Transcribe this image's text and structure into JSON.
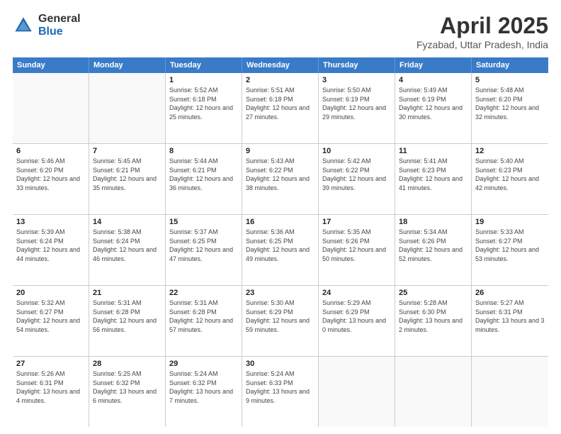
{
  "header": {
    "logo_general": "General",
    "logo_blue": "Blue",
    "month_title": "April 2025",
    "location": "Fyzabad, Uttar Pradesh, India"
  },
  "days_of_week": [
    "Sunday",
    "Monday",
    "Tuesday",
    "Wednesday",
    "Thursday",
    "Friday",
    "Saturday"
  ],
  "weeks": [
    [
      {
        "day": "",
        "sunrise": "",
        "sunset": "",
        "daylight": ""
      },
      {
        "day": "",
        "sunrise": "",
        "sunset": "",
        "daylight": ""
      },
      {
        "day": "1",
        "sunrise": "Sunrise: 5:52 AM",
        "sunset": "Sunset: 6:18 PM",
        "daylight": "Daylight: 12 hours and 25 minutes."
      },
      {
        "day": "2",
        "sunrise": "Sunrise: 5:51 AM",
        "sunset": "Sunset: 6:18 PM",
        "daylight": "Daylight: 12 hours and 27 minutes."
      },
      {
        "day": "3",
        "sunrise": "Sunrise: 5:50 AM",
        "sunset": "Sunset: 6:19 PM",
        "daylight": "Daylight: 12 hours and 29 minutes."
      },
      {
        "day": "4",
        "sunrise": "Sunrise: 5:49 AM",
        "sunset": "Sunset: 6:19 PM",
        "daylight": "Daylight: 12 hours and 30 minutes."
      },
      {
        "day": "5",
        "sunrise": "Sunrise: 5:48 AM",
        "sunset": "Sunset: 6:20 PM",
        "daylight": "Daylight: 12 hours and 32 minutes."
      }
    ],
    [
      {
        "day": "6",
        "sunrise": "Sunrise: 5:46 AM",
        "sunset": "Sunset: 6:20 PM",
        "daylight": "Daylight: 12 hours and 33 minutes."
      },
      {
        "day": "7",
        "sunrise": "Sunrise: 5:45 AM",
        "sunset": "Sunset: 6:21 PM",
        "daylight": "Daylight: 12 hours and 35 minutes."
      },
      {
        "day": "8",
        "sunrise": "Sunrise: 5:44 AM",
        "sunset": "Sunset: 6:21 PM",
        "daylight": "Daylight: 12 hours and 36 minutes."
      },
      {
        "day": "9",
        "sunrise": "Sunrise: 5:43 AM",
        "sunset": "Sunset: 6:22 PM",
        "daylight": "Daylight: 12 hours and 38 minutes."
      },
      {
        "day": "10",
        "sunrise": "Sunrise: 5:42 AM",
        "sunset": "Sunset: 6:22 PM",
        "daylight": "Daylight: 12 hours and 39 minutes."
      },
      {
        "day": "11",
        "sunrise": "Sunrise: 5:41 AM",
        "sunset": "Sunset: 6:23 PM",
        "daylight": "Daylight: 12 hours and 41 minutes."
      },
      {
        "day": "12",
        "sunrise": "Sunrise: 5:40 AM",
        "sunset": "Sunset: 6:23 PM",
        "daylight": "Daylight: 12 hours and 42 minutes."
      }
    ],
    [
      {
        "day": "13",
        "sunrise": "Sunrise: 5:39 AM",
        "sunset": "Sunset: 6:24 PM",
        "daylight": "Daylight: 12 hours and 44 minutes."
      },
      {
        "day": "14",
        "sunrise": "Sunrise: 5:38 AM",
        "sunset": "Sunset: 6:24 PM",
        "daylight": "Daylight: 12 hours and 46 minutes."
      },
      {
        "day": "15",
        "sunrise": "Sunrise: 5:37 AM",
        "sunset": "Sunset: 6:25 PM",
        "daylight": "Daylight: 12 hours and 47 minutes."
      },
      {
        "day": "16",
        "sunrise": "Sunrise: 5:36 AM",
        "sunset": "Sunset: 6:25 PM",
        "daylight": "Daylight: 12 hours and 49 minutes."
      },
      {
        "day": "17",
        "sunrise": "Sunrise: 5:35 AM",
        "sunset": "Sunset: 6:26 PM",
        "daylight": "Daylight: 12 hours and 50 minutes."
      },
      {
        "day": "18",
        "sunrise": "Sunrise: 5:34 AM",
        "sunset": "Sunset: 6:26 PM",
        "daylight": "Daylight: 12 hours and 52 minutes."
      },
      {
        "day": "19",
        "sunrise": "Sunrise: 5:33 AM",
        "sunset": "Sunset: 6:27 PM",
        "daylight": "Daylight: 12 hours and 53 minutes."
      }
    ],
    [
      {
        "day": "20",
        "sunrise": "Sunrise: 5:32 AM",
        "sunset": "Sunset: 6:27 PM",
        "daylight": "Daylight: 12 hours and 54 minutes."
      },
      {
        "day": "21",
        "sunrise": "Sunrise: 5:31 AM",
        "sunset": "Sunset: 6:28 PM",
        "daylight": "Daylight: 12 hours and 56 minutes."
      },
      {
        "day": "22",
        "sunrise": "Sunrise: 5:31 AM",
        "sunset": "Sunset: 6:28 PM",
        "daylight": "Daylight: 12 hours and 57 minutes."
      },
      {
        "day": "23",
        "sunrise": "Sunrise: 5:30 AM",
        "sunset": "Sunset: 6:29 PM",
        "daylight": "Daylight: 12 hours and 59 minutes."
      },
      {
        "day": "24",
        "sunrise": "Sunrise: 5:29 AM",
        "sunset": "Sunset: 6:29 PM",
        "daylight": "Daylight: 13 hours and 0 minutes."
      },
      {
        "day": "25",
        "sunrise": "Sunrise: 5:28 AM",
        "sunset": "Sunset: 6:30 PM",
        "daylight": "Daylight: 13 hours and 2 minutes."
      },
      {
        "day": "26",
        "sunrise": "Sunrise: 5:27 AM",
        "sunset": "Sunset: 6:31 PM",
        "daylight": "Daylight: 13 hours and 3 minutes."
      }
    ],
    [
      {
        "day": "27",
        "sunrise": "Sunrise: 5:26 AM",
        "sunset": "Sunset: 6:31 PM",
        "daylight": "Daylight: 13 hours and 4 minutes."
      },
      {
        "day": "28",
        "sunrise": "Sunrise: 5:25 AM",
        "sunset": "Sunset: 6:32 PM",
        "daylight": "Daylight: 13 hours and 6 minutes."
      },
      {
        "day": "29",
        "sunrise": "Sunrise: 5:24 AM",
        "sunset": "Sunset: 6:32 PM",
        "daylight": "Daylight: 13 hours and 7 minutes."
      },
      {
        "day": "30",
        "sunrise": "Sunrise: 5:24 AM",
        "sunset": "Sunset: 6:33 PM",
        "daylight": "Daylight: 13 hours and 9 minutes."
      },
      {
        "day": "",
        "sunrise": "",
        "sunset": "",
        "daylight": ""
      },
      {
        "day": "",
        "sunrise": "",
        "sunset": "",
        "daylight": ""
      },
      {
        "day": "",
        "sunrise": "",
        "sunset": "",
        "daylight": ""
      }
    ]
  ]
}
